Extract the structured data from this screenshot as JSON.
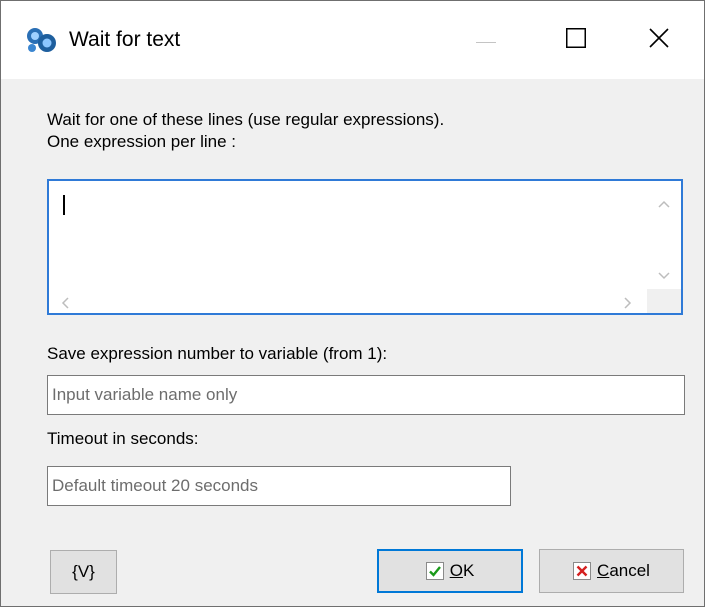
{
  "window": {
    "title": "Wait for text",
    "controls": {
      "minimize_icon": "minimize-icon",
      "maximize_icon": "maximize-icon",
      "close_icon": "close-icon"
    }
  },
  "main": {
    "instructions_line1": "Wait for one of these lines (use regular expressions).",
    "instructions_line2": "One expression per line :",
    "expressions_value": "",
    "save_label": "Save expression number to variable (from 1):",
    "variable_placeholder": "Input variable name only",
    "variable_value": "",
    "timeout_label": "Timeout in seconds:",
    "timeout_placeholder": "Default timeout 20 seconds",
    "timeout_value": ""
  },
  "footer": {
    "variables_button": "{V}",
    "ok_accel": "O",
    "ok_rest": "K",
    "cancel_accel": "C",
    "cancel_rest": "ancel"
  },
  "colors": {
    "focus_border": "#2f7ad7",
    "ok_check": "#1a9a1a",
    "cancel_x": "#d42020"
  }
}
